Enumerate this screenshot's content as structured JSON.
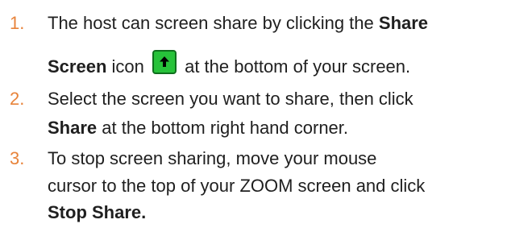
{
  "steps": [
    {
      "number": "1.",
      "line1_text": "The host can screen share by clicking the ",
      "line1_bold": "Share",
      "line2_bold": "Screen",
      "line2_text_before_icon": " icon ",
      "icon": "share-screen-arrow-up-icon",
      "line2_text_after_icon": " at the bottom of your screen."
    },
    {
      "number": "2.",
      "line1_text": "Select the screen you want to share, then click",
      "line2_bold": "Share",
      "line2_text": " at the bottom right hand corner."
    },
    {
      "number": "3.",
      "line1_text": "To stop screen sharing, move your mouse",
      "line2_text": "cursor to the top of your ZOOM screen and click",
      "line3_bold": "Stop Share."
    }
  ],
  "colors": {
    "number_orange": "#e8833a",
    "icon_green": "#27c23a",
    "icon_border": "#0f6f1d"
  }
}
